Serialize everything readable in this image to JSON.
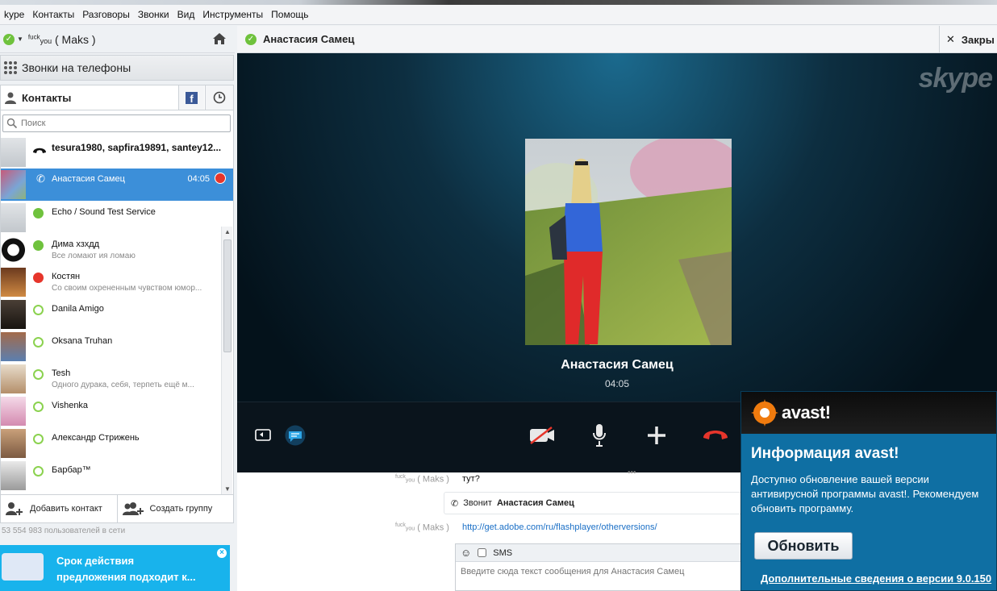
{
  "menu": [
    "kype",
    "Контакты",
    "Разговоры",
    "Звонки",
    "Вид",
    "Инструменты",
    "Помощь"
  ],
  "user": {
    "prefix": "fuck",
    "sub": "you",
    "name": "( Maks )"
  },
  "calls_label": "Звонки на телефоны",
  "contacts_label": "Контакты",
  "search_placeholder": "Поиск",
  "contacts": [
    {
      "name": "tesura1980, sapfira19891, santey12...",
      "mood": "",
      "status": "call",
      "bold": true
    },
    {
      "name": "Анастасия Самец",
      "mood": "",
      "status": "active-call",
      "time": "04:05"
    },
    {
      "name": "Echo / Sound Test Service",
      "mood": "",
      "status": "online"
    },
    {
      "name": "Дима хзхдд",
      "mood": "Все ломают ия ломаю",
      "status": "online"
    },
    {
      "name": "Костян",
      "mood": "Со своим охрененным чувством юмор...",
      "status": "busy"
    },
    {
      "name": "Danila Amigo",
      "mood": "",
      "status": "offline"
    },
    {
      "name": "Oksana Truhan",
      "mood": "",
      "status": "offline"
    },
    {
      "name": "Tesh",
      "mood": "Одного дурака, себя, терпеть ещё м...",
      "status": "offline"
    },
    {
      "name": "Vishenka",
      "mood": "",
      "status": "offline"
    },
    {
      "name": "Александр Стрижень",
      "mood": "",
      "status": "offline"
    },
    {
      "name": "Барбар™",
      "mood": "",
      "status": "offline"
    }
  ],
  "add_contact": "Добавить контакт",
  "create_group": "Создать группу",
  "online_count": "53 554 983 пользователей в сети",
  "promo": {
    "line1": "Срок действия",
    "line2": "предложения подходит к..."
  },
  "conversation": {
    "title": "Анастасия Самец",
    "close": "Закры",
    "caller": "Анастасия Самец",
    "duration": "04:05",
    "skype_logo": "skype"
  },
  "chat": {
    "sender1": {
      "prefix": "fuck",
      "sub": "you",
      "name": "( Maks )"
    },
    "msg1": "тут?",
    "calling_prefix": "Звонит",
    "calling_name": "Анастасия Самец",
    "sender2": {
      "prefix": "fuck",
      "sub": "you",
      "name": "( Maks )"
    },
    "link": "http://get.adobe.com/ru/flashplayer/otherversions/",
    "sms_label": "SMS",
    "compose_placeholder": "Введите сюда текст сообщения для Анастасия Самец"
  },
  "avast": {
    "logo": "avast!",
    "title": "Информация avast!",
    "desc": "Доступно обновление вашей версии антивирусной программы avast!. Рекомендуем обновить программу.",
    "button": "Обновить",
    "link": "Дополнительные сведения о версии 9.0.150"
  },
  "colors": {
    "accent": "#3c8fd9",
    "online": "#6fc23d",
    "busy": "#e6352b",
    "avast_blue": "#0f6fa3"
  }
}
